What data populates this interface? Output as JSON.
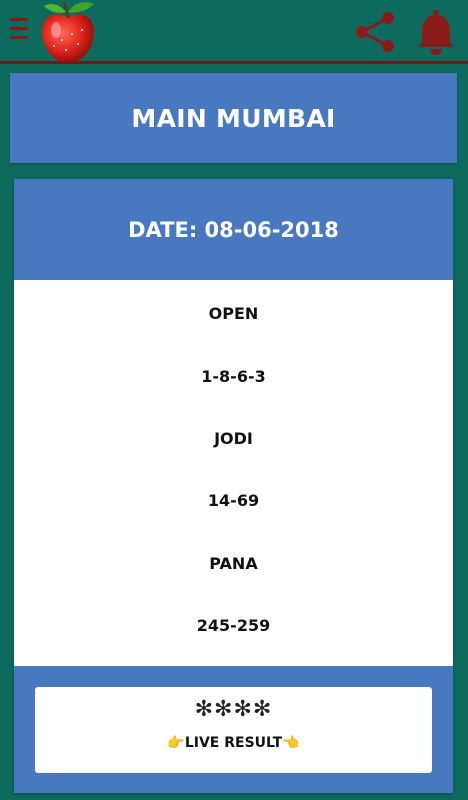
{
  "header": {
    "menu_icon": "hamburger-menu-icon",
    "logo_icon": "apple-logo-icon",
    "share_icon": "share-icon",
    "notification_icon": "bell-icon"
  },
  "market": {
    "title": "MAIN MUMBAI"
  },
  "result": {
    "date_label": "DATE: 08-06-2018",
    "open_label": "OPEN",
    "open_value": "1-8-6-3",
    "jodi_label": "JODI",
    "jodi_value": "14-69",
    "pana_label": "PANA",
    "pana_value": "245-259"
  },
  "live": {
    "stars": "✻✻✻✻",
    "label": "👉LIVE RESULT👈"
  },
  "colors": {
    "background": "#0d6b5e",
    "card": "#4878bf",
    "accent": "#8b1a1a"
  }
}
